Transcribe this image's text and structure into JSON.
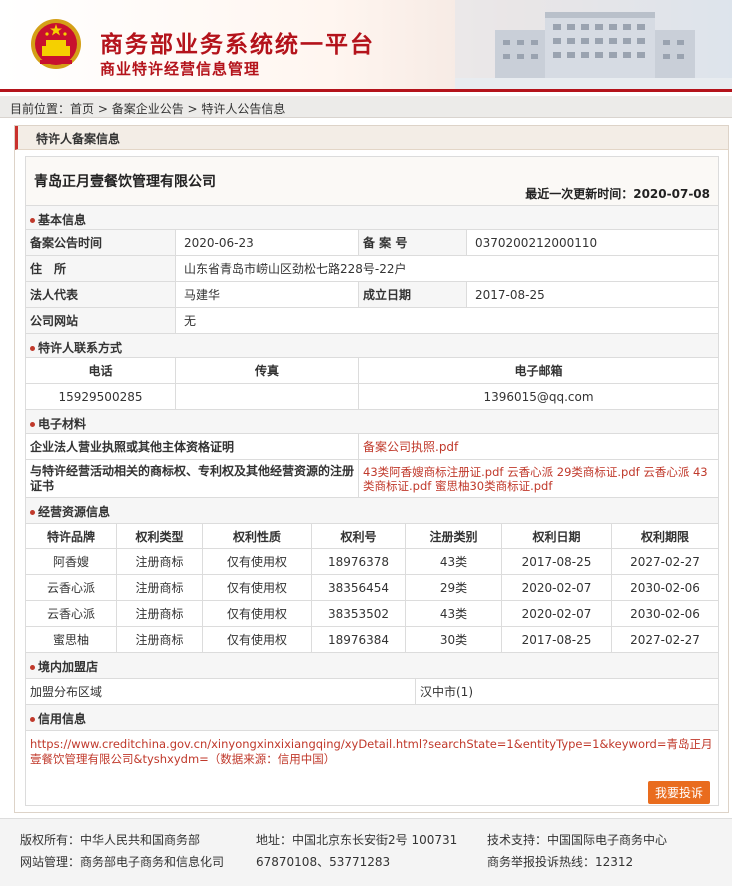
{
  "header": {
    "title": "商务部业务系统统一平台",
    "subtitle": "商业特许经营信息管理"
  },
  "breadcrumb": {
    "prefix": "目前位置：",
    "items": [
      "首页",
      "备案企业公告",
      "特许人公告信息"
    ],
    "sep": " > "
  },
  "panel_title": "特许人备案信息",
  "company": {
    "name": "青岛正月壹餐饮管理有限公司",
    "updated_label": "最近一次更新时间：",
    "updated": "2020-07-08"
  },
  "basic": {
    "section": "基本信息",
    "publish_date_label": "备案公告时间",
    "publish_date": "2020-06-23",
    "record_no_label": "备 案 号",
    "record_no": "0370200212000110",
    "address_label": "住　所",
    "address": "山东省青岛市崂山区劲松七路228号-22户",
    "legal_rep_label": "法人代表",
    "legal_rep": "马建华",
    "established_label": "成立日期",
    "established": "2017-08-25",
    "website_label": "公司网站",
    "website": "无"
  },
  "contact": {
    "section": "特许人联系方式",
    "headers": [
      "电话",
      "传真",
      "电子邮箱"
    ],
    "phone": "15929500285",
    "fax": "",
    "email": "1396015@qq.com"
  },
  "materials": {
    "section": "电子材料",
    "license_label": "企业法人营业执照或其他主体资格证明",
    "license_link": "备案公司执照.pdf",
    "trademark_label": "与特许经营活动相关的商标权、专利权及其他经营资源的注册证书",
    "trademark_links": "43类阿香嫂商标注册证.pdf 云香心派 29类商标证.pdf 云香心派 43类商标证.pdf 蜜思柚30类商标证.pdf"
  },
  "resources": {
    "section": "经营资源信息",
    "headers": [
      "特许品牌",
      "权利类型",
      "权利性质",
      "权利号",
      "注册类别",
      "权利日期",
      "权利期限"
    ],
    "rows": [
      [
        "阿香嫂",
        "注册商标",
        "仅有使用权",
        "18976378",
        "43类",
        "2017-08-25",
        "2027-02-27"
      ],
      [
        "云香心派",
        "注册商标",
        "仅有使用权",
        "38356454",
        "29类",
        "2020-02-07",
        "2030-02-06"
      ],
      [
        "云香心派",
        "注册商标",
        "仅有使用权",
        "38353502",
        "43类",
        "2020-02-07",
        "2030-02-06"
      ],
      [
        "蜜思柚",
        "注册商标",
        "仅有使用权",
        "18976384",
        "30类",
        "2017-08-25",
        "2027-02-27"
      ]
    ]
  },
  "stores": {
    "section": "境内加盟店",
    "region_label": "加盟分布区域",
    "region_value": "汉中市(1)"
  },
  "credit": {
    "section": "信用信息",
    "link": "https://www.creditchina.gov.cn/xinyongxinxixiangqing/xyDetail.html?searchState=1&entityType=1&keyword=青岛正月壹餐饮管理有限公司&tyshxydm=（数据来源：信用中国）"
  },
  "complain_button": "我要投诉",
  "footer": {
    "owner": "版权所有：中华人民共和国商务部",
    "address": "地址：中国北京东长安街2号 100731",
    "support": "技术支持：中国国际电子商务中心",
    "manager": "网站管理：商务部电子商务和信息化司",
    "phones": "67870108、53771283",
    "hotline": "商务举报投诉热线：12312"
  },
  "colors": {
    "brand_red": "#b4131b",
    "link_red": "#c0392b",
    "button_orange": "#e96c1e"
  }
}
